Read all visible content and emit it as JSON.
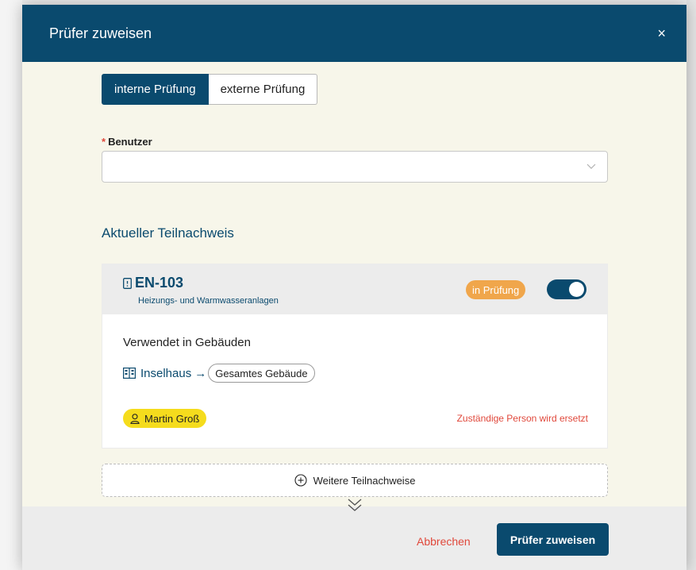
{
  "modal": {
    "title": "Prüfer zuweisen",
    "close_label": "×"
  },
  "segment": {
    "options": [
      "interne Prüfung",
      "externe Prüfung"
    ],
    "selected": "interne Prüfung"
  },
  "user_field": {
    "required_marker": "*",
    "label": "Benutzer",
    "value": ""
  },
  "section": {
    "title": "Aktueller Teilnachweis"
  },
  "card": {
    "icon": "document-icon",
    "code": "EN-103",
    "subtitle": "Heizungs- und Warmwasseranlagen",
    "status_badge": "in Prüfung",
    "toggle_on": true,
    "used_title": "Verwendet in Gebäuden",
    "building": {
      "icon": "building-icon",
      "name": "Inselhaus",
      "arrow": "→",
      "scope": "Gesamtes Gebäude"
    },
    "person": {
      "icon": "user-icon",
      "name": "Martin Groß"
    },
    "replace_note": "Zuständige Person wird ersetzt"
  },
  "more": {
    "icon": "plus-circle-icon",
    "label": "Weitere Teilnachweise"
  },
  "footer": {
    "cancel_label": "Abbrechen",
    "submit_label": "Prüfer zuweisen"
  },
  "colors": {
    "primary": "#0a4a6e",
    "badge": "#f0a64b",
    "person_badge": "#f5dc1d",
    "danger": "#e0483b",
    "modal_bg": "#f7f6ea"
  }
}
